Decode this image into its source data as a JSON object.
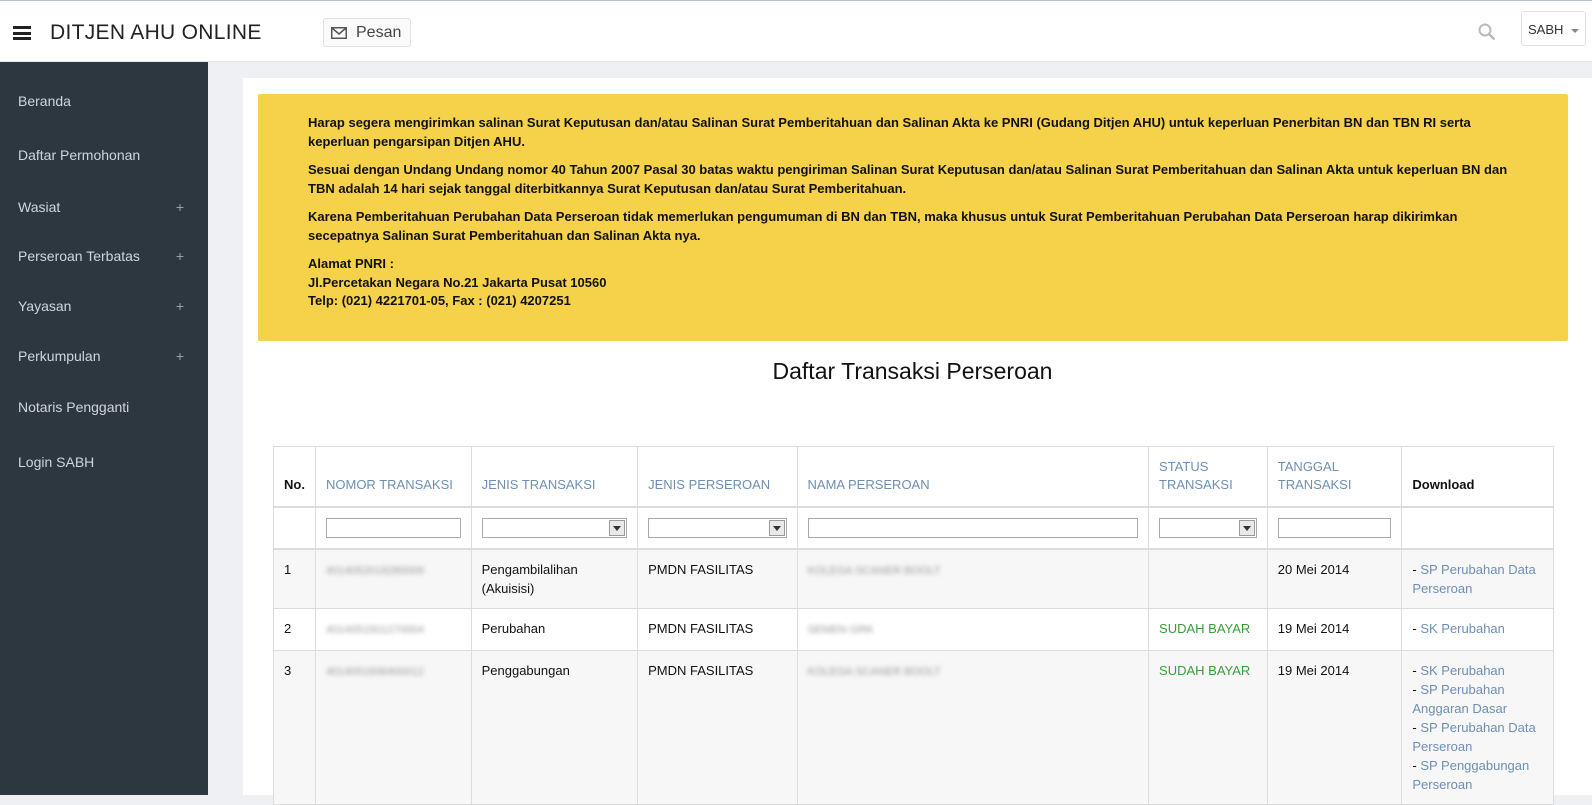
{
  "header": {
    "title": "DITJEN AHU ONLINE",
    "message_label": "Pesan",
    "user_label": "SABH"
  },
  "sidebar": {
    "items": [
      {
        "label": "Beranda",
        "expandable": false
      },
      {
        "label": "Daftar Permohonan",
        "expandable": false
      },
      {
        "label": "Wasiat",
        "expandable": true
      },
      {
        "label": "Perseroan Terbatas",
        "expandable": true
      },
      {
        "label": "Yayasan",
        "expandable": true
      },
      {
        "label": "Perkumpulan",
        "expandable": true
      },
      {
        "label": "Notaris Pengganti",
        "expandable": false
      },
      {
        "label": "Login SABH",
        "expandable": false
      }
    ],
    "expand_symbol": "+"
  },
  "notice": {
    "p1": "Harap segera mengirimkan salinan Surat Keputusan dan/atau Salinan Surat Pemberitahuan dan Salinan Akta ke PNRI (Gudang Ditjen AHU) untuk keperluan Penerbitan BN dan TBN RI serta keperluan pengarsipan Ditjen AHU.",
    "p2": "Sesuai dengan Undang Undang nomor 40 Tahun 2007 Pasal 30 batas waktu pengiriman Salinan Surat Keputusan dan/atau Salinan Surat Pemberitahuan dan Salinan Akta untuk keperluan BN dan TBN adalah 14 hari sejak tanggal diterbitkannya Surat Keputusan dan/atau Surat Pemberitahuan.",
    "p3": "Karena Pemberitahuan Perubahan Data Perseroan tidak memerlukan pengumuman di BN dan TBN, maka khusus untuk Surat Pemberitahuan Perubahan Data Perseroan harap dikirimkan secepatnya Salinan Surat Pemberitahuan dan Salinan Akta nya.",
    "addr_label": "Alamat PNRI :",
    "addr_line": "Jl.Percetakan Negara No.21 Jakarta Pusat 10560",
    "phone_line": "Telp: (021) 4221701-05, Fax : (021) 4207251"
  },
  "page_title": "Daftar Transaksi Perseroan",
  "table": {
    "columns": [
      "No.",
      "NOMOR TRANSAKSI",
      "JENIS TRANSAKSI",
      "JENIS PERSEROAN",
      "NAMA PERSEROAN",
      "STATUS TRANSAKSI",
      "TANGGAL TRANSAKSI",
      "Download"
    ],
    "rows": [
      {
        "no": "1",
        "nomor": "4014052019280009",
        "jenis": "Pengambilalihan (Akuisisi)",
        "jenis_perseroan": "PMDN FASILITAS",
        "nama": "KOLEGA SCANER BOOLT",
        "status": "",
        "tanggal": "20 Mei 2014",
        "downloads": [
          "SP Perubahan Data Perseroan"
        ]
      },
      {
        "no": "2",
        "nomor": "4014051501270004",
        "jenis": "Perubahan",
        "jenis_perseroan": "PMDN FASILITAS",
        "nama": "SEMEN GRK",
        "status": "SUDAH BAYAR",
        "tanggal": "19 Mei 2014",
        "downloads": [
          "SK Perubahan"
        ]
      },
      {
        "no": "3",
        "nomor": "4014051936400012",
        "jenis": "Penggabungan",
        "jenis_perseroan": "PMDN FASILITAS",
        "nama": "KOLEGA SCANER BOOLT",
        "status": "SUDAH BAYAR",
        "tanggal": "19 Mei 2014",
        "downloads": [
          "SK Perubahan",
          "SP Perubahan Anggaran Dasar",
          "SP Perubahan Data Perseroan",
          "SP Penggabungan Perseroan"
        ]
      }
    ],
    "download_prefix": "- "
  },
  "colors": {
    "sidebar_bg": "#2c3740",
    "notice_bg": "#f6d24a",
    "link": "#6d8fb4",
    "status_paid": "#3a9d3a"
  }
}
